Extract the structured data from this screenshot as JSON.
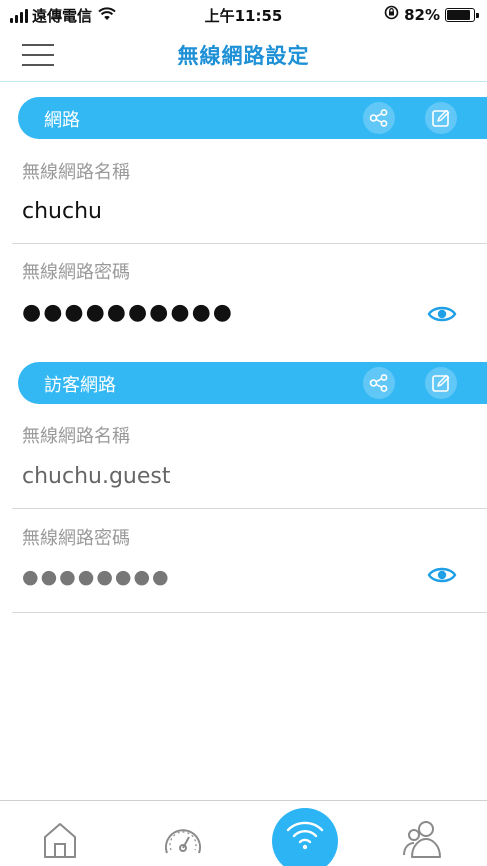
{
  "status_bar": {
    "carrier": "遠傳電信",
    "time": "上午11:55",
    "battery_percent": "82%",
    "battery_level": 0.82
  },
  "header": {
    "title": "無線網路設定",
    "menu_icon": "hamburger-menu-icon"
  },
  "sections": [
    {
      "title": "網路",
      "fields": [
        {
          "label": "無線網路名稱",
          "value": "chuchu"
        },
        {
          "label": "無線網路密碼",
          "value": "●●●●●●●●●●"
        }
      ]
    },
    {
      "title": "訪客網路",
      "fields": [
        {
          "label": "無線網路名稱",
          "value": "chuchu.guest"
        },
        {
          "label": "無線網路密碼",
          "value": "●●●●●●●●"
        }
      ]
    }
  ],
  "icons": {
    "share": "share-icon",
    "edit": "edit-icon",
    "eye": "eye-icon",
    "home": "home-icon",
    "speedometer": "speedometer-icon",
    "wifi": "wifi-icon",
    "users": "users-icon"
  },
  "colors": {
    "accent": "#34b8f4",
    "title_blue": "#1e90d6",
    "eye_blue": "#1e9fe6",
    "tab_active": "#2db4f5"
  }
}
